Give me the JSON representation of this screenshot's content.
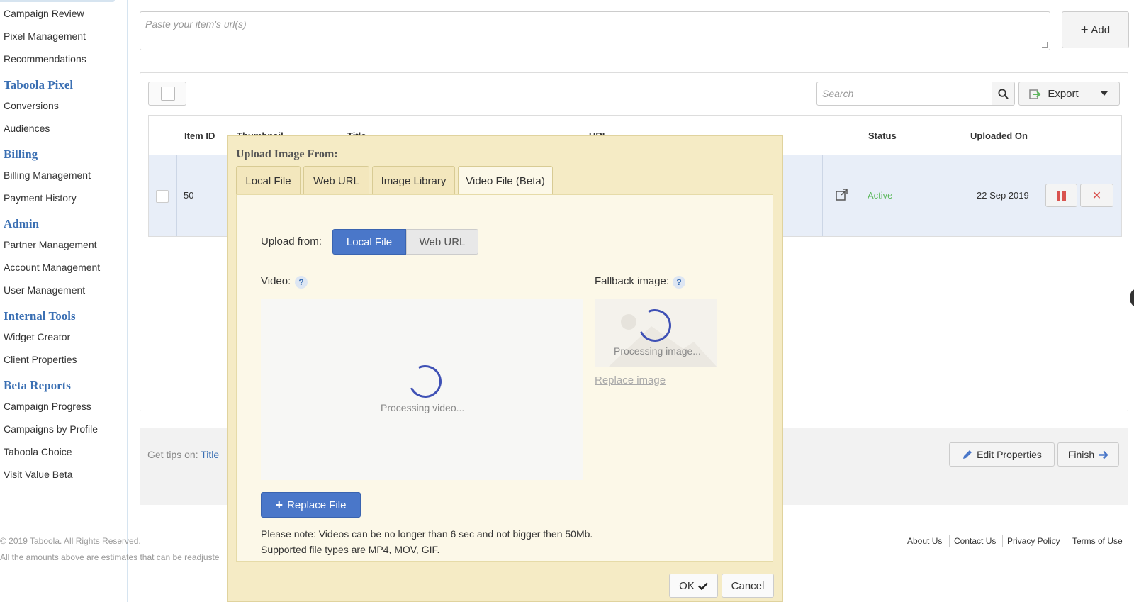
{
  "sidebar": {
    "items_top": [
      "Campaign Review",
      "Pixel Management",
      "Recommendations"
    ],
    "section_pixel": "Taboola Pixel",
    "items_pixel": [
      "Conversions",
      "Audiences"
    ],
    "section_billing": "Billing",
    "items_billing": [
      "Billing Management",
      "Payment History"
    ],
    "section_admin": "Admin",
    "items_admin": [
      "Partner Management",
      "Account Management",
      "User Management"
    ],
    "section_internal": "Internal Tools",
    "items_internal": [
      "Widget Creator",
      "Client Properties"
    ],
    "section_beta": "Beta Reports",
    "items_beta": [
      "Campaign Progress",
      "Campaigns by Profile",
      "Taboola Choice",
      "Visit Value Beta"
    ]
  },
  "url_input": {
    "placeholder": "Paste your item's url(s)"
  },
  "add_button": "Add",
  "toolbar": {
    "search_placeholder": "Search",
    "export_label": "Export"
  },
  "table": {
    "columns": [
      "Item ID",
      "Thumbnail",
      "Title",
      "URL",
      "Status",
      "Uploaded On"
    ],
    "row": {
      "item_id": "50",
      "status": "Active",
      "uploaded_on": "22 Sep 2019"
    }
  },
  "tips": {
    "prefix": "Get tips on:",
    "link": "Title"
  },
  "actions": {
    "edit": "Edit Properties",
    "finish": "Finish"
  },
  "footer": {
    "copyright": "© 2019 Taboola. All Rights Reserved.",
    "disclaimer": "All the amounts above are estimates that can be readjuste",
    "links": [
      "About Us",
      "Contact Us",
      "Privacy Policy",
      "Terms of Use"
    ]
  },
  "dialog": {
    "title": "Upload Image From:",
    "tabs": [
      "Local File",
      "Web URL",
      "Image Library",
      "Video File (Beta)"
    ],
    "active_tab": "Video File (Beta)",
    "upload_from_label": "Upload from:",
    "upload_options": [
      "Local File",
      "Web URL"
    ],
    "video_label": "Video:",
    "fallback_label": "Fallback image:",
    "help": "?",
    "processing_video": "Processing video...",
    "processing_image": "Processing image...",
    "replace_image": "Replace image",
    "replace_file": "Replace File",
    "note_line1": "Please note: Videos can be no longer than 6 sec and not bigger then 50Mb.",
    "note_line2": "Supported file types are MP4, MOV, GIF.",
    "ok": "OK",
    "cancel": "Cancel"
  },
  "colors": {
    "accent": "#4a77c9",
    "section_heading": "#3a6fb3",
    "status_active": "#5cb85c",
    "danger": "#d9534f",
    "dialog_bg": "#f5ebc5"
  }
}
